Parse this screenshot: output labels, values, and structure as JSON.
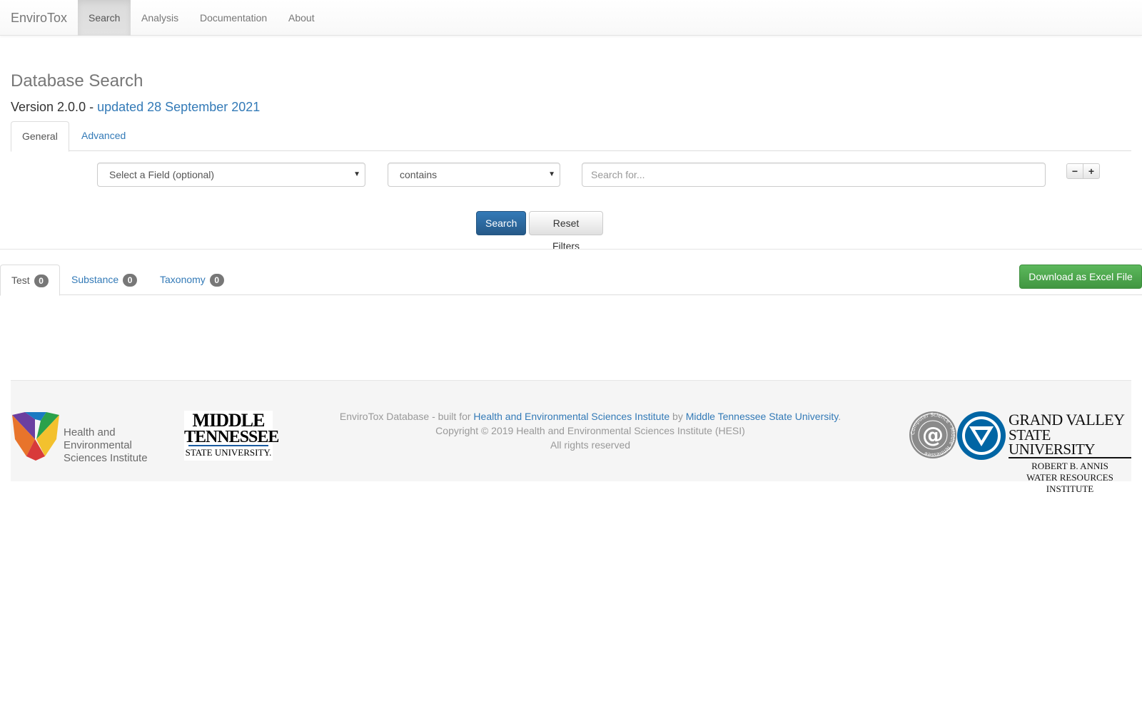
{
  "navbar": {
    "brand": "EnviroTox",
    "items": [
      {
        "label": "Search",
        "active": true
      },
      {
        "label": "Analysis",
        "active": false
      },
      {
        "label": "Documentation",
        "active": false
      },
      {
        "label": "About",
        "active": false
      }
    ]
  },
  "header": {
    "title": "Database Search",
    "version_prefix": "Version 2.0.0 - ",
    "version_link": "updated 28 September 2021"
  },
  "search_tabs": [
    {
      "label": "General",
      "active": true
    },
    {
      "label": "Advanced",
      "active": false
    }
  ],
  "filter": {
    "field_select": "Select a Field (optional)",
    "operator_select": "contains",
    "search_placeholder": "Search for...",
    "search_value": "",
    "remove_icon": "minus-icon",
    "add_icon": "plus-icon"
  },
  "actions": {
    "search_label": "Search",
    "reset_label": "Reset Filters"
  },
  "result_tabs": [
    {
      "label": "Test",
      "count": "0",
      "active": true
    },
    {
      "label": "Substance",
      "count": "0",
      "active": false
    },
    {
      "label": "Taxonomy",
      "count": "0",
      "active": false
    }
  ],
  "download_label": "Download as Excel File",
  "footer": {
    "built_prefix": "EnviroTox Database - built for ",
    "hesi_link": "Health and Environmental Sciences Institute",
    "by": " by ",
    "mtsu_link": "Middle Tennessee State University",
    "period": ".",
    "copyright": "Copyright © 2019 Health and Environmental Sciences Institute (HESI)",
    "rights": "All rights reserved",
    "logos": {
      "hesi_line1": "Health and Environmental",
      "hesi_line2": "Sciences Institute",
      "mtsu_line1": "MIDDLE",
      "mtsu_line2": "TENNESSEE",
      "mtsu_line3": "STATE UNIVERSITY.",
      "cs_ring_text": "Computer Science · Middle Tennessee",
      "gv_line1": "GRAND VALLEY",
      "gv_line2": "STATE UNIVERSITY",
      "gv_line3": "ROBERT B. ANNIS",
      "gv_line4": "WATER RESOURCES INSTITUTE"
    }
  },
  "colors": {
    "link": "#337ab7",
    "primary": "#337ab7",
    "success": "#5cb85c",
    "badge": "#777777",
    "gv_blue": "#0065a4"
  }
}
